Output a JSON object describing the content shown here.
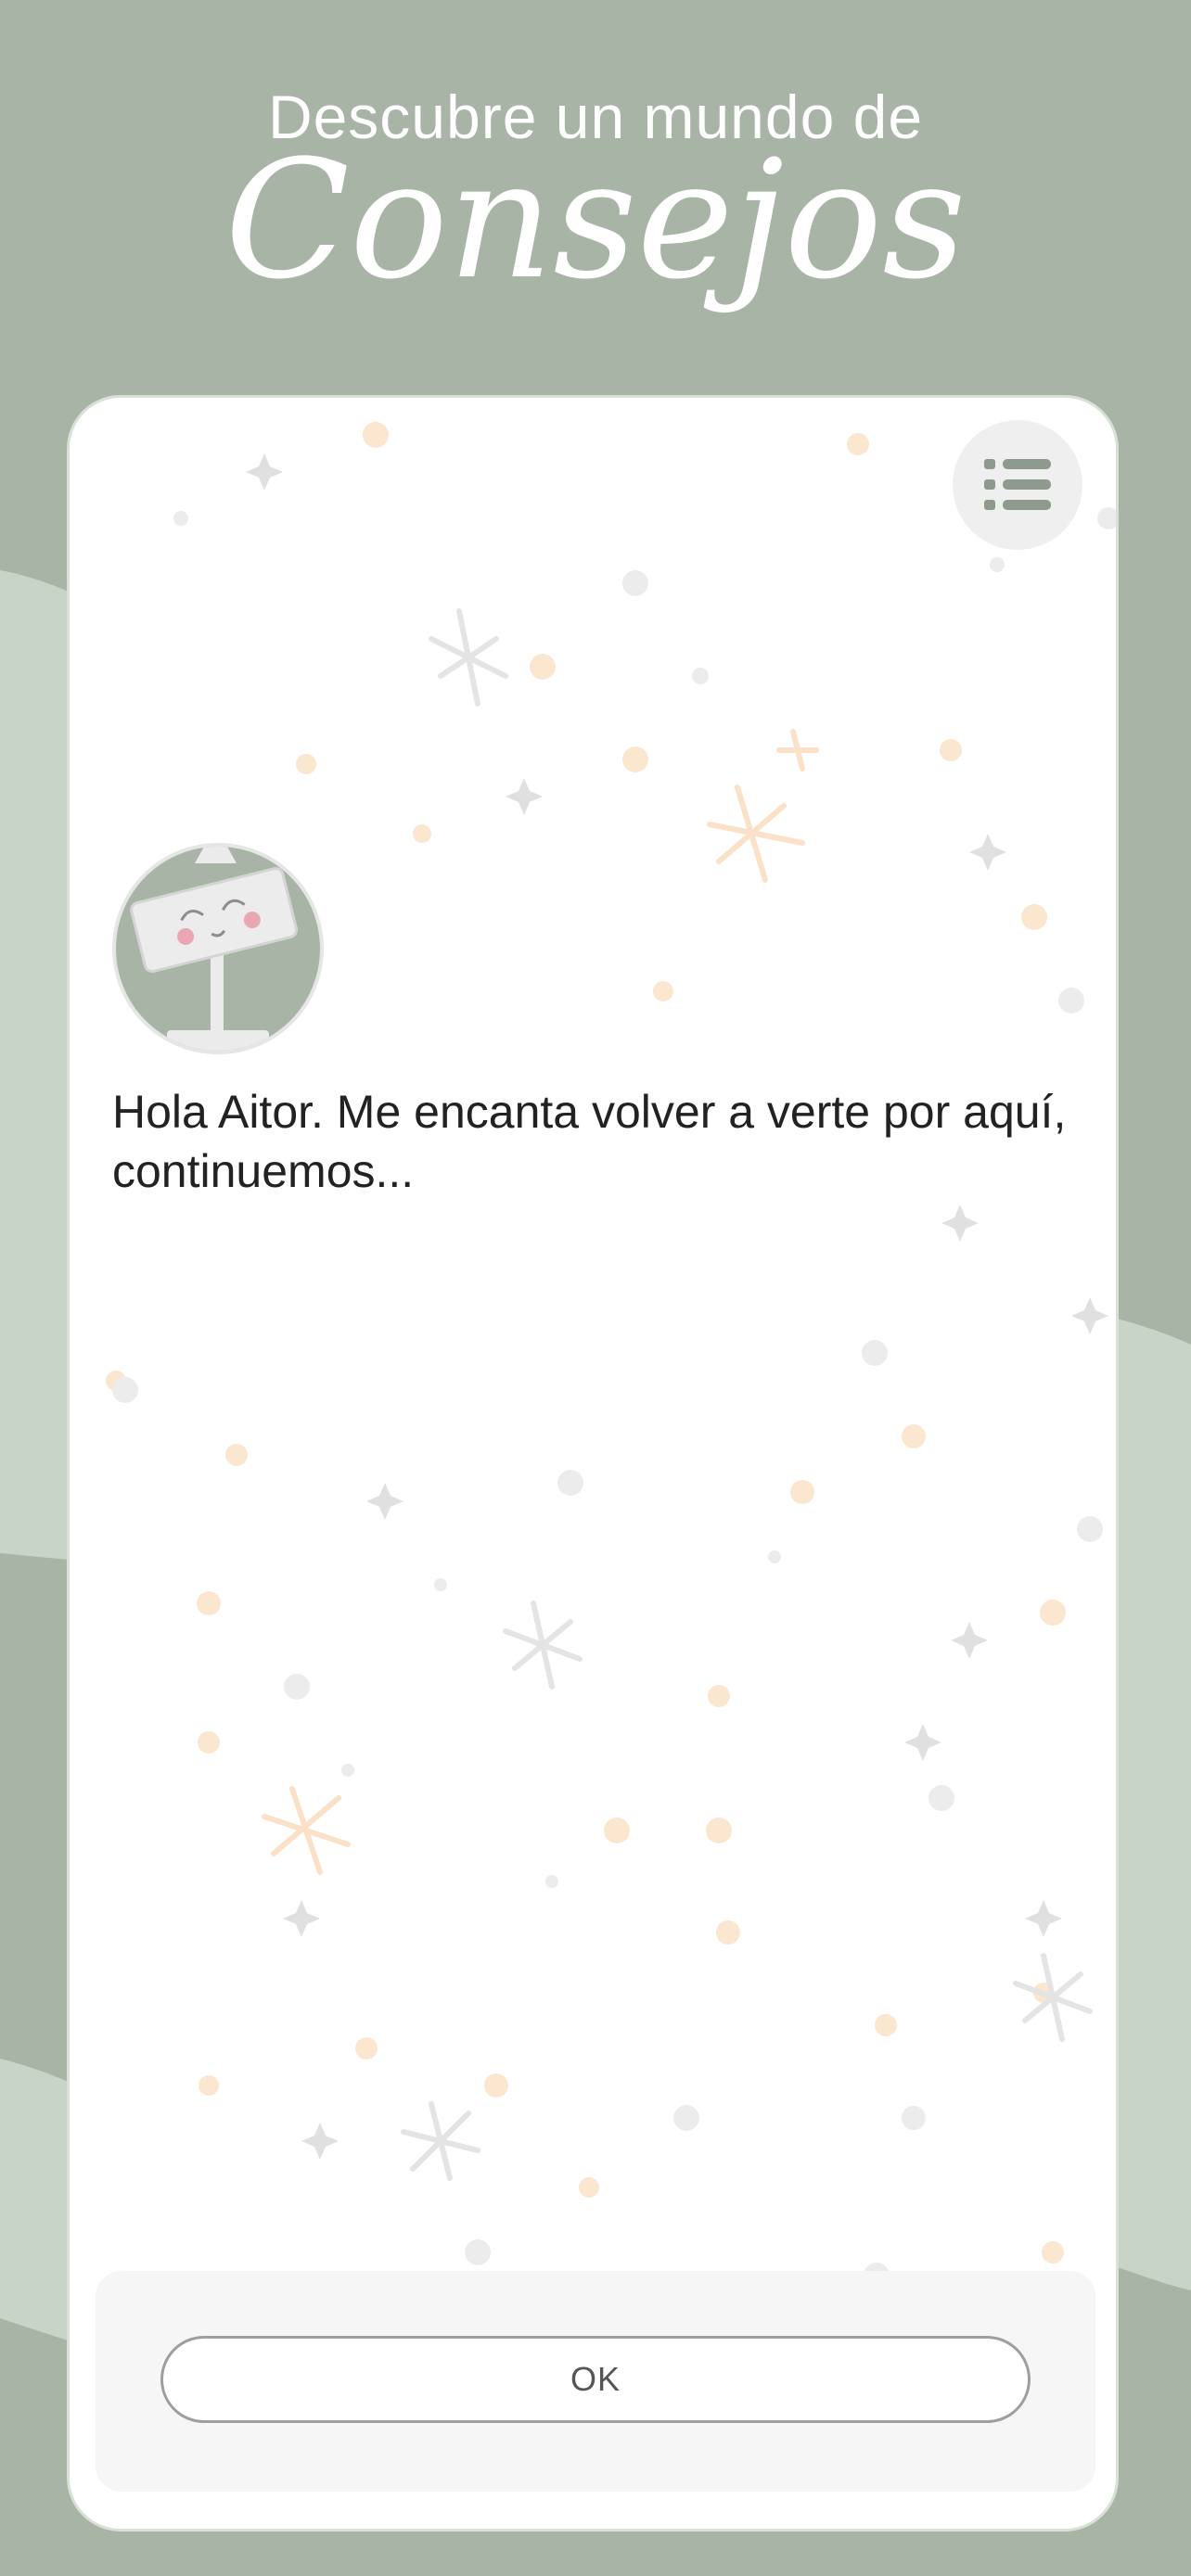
{
  "header": {
    "tagline": "Descubre un mundo de",
    "title": "Consejos"
  },
  "card": {
    "message": "Hola Aitor. Me encanta volver a verte por aquí, continuemos..."
  },
  "menu": {
    "icon": "list-icon"
  },
  "avatar": {
    "icon": "mascot-avatar"
  },
  "footer": {
    "ok_label": "OK"
  },
  "colors": {
    "background": "#a7b4a6",
    "background_light": "#c9d4c8",
    "card": "#ffffff",
    "text": "#222222",
    "accent": "#8e9a8d"
  }
}
